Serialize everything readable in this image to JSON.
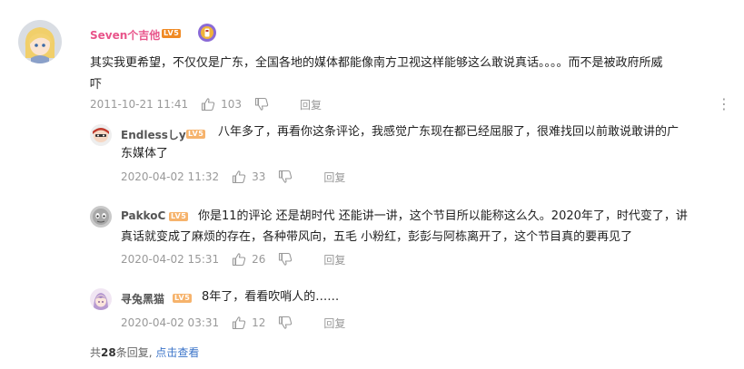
{
  "main_comment": {
    "username": "Seven个吉他",
    "level": "LV5",
    "text_line1": "其实我更希望，不仅仅是广东，全国各地的媒体都能像南方卫视这样能够这么敢说真话。。。。而不是被政府所威",
    "text_line2": "吓",
    "timestamp": "2011-10-21 11:41",
    "likes": "103",
    "reply_label": "回复",
    "more_label": "⋮"
  },
  "replies": [
    {
      "username": "Endlessしу",
      "level": "LV5",
      "text_line1": "八年多了，再看你这条评论，我感觉广东现在都已经屈服了，很难找回以前敢说敢讲的广",
      "text_line2": "东媒体了",
      "timestamp": "2020-04-02 11:32",
      "likes": "33",
      "reply_label": "回复"
    },
    {
      "username": "PakkoC",
      "level": "LV5",
      "text_line1": "你是11的评论 还是胡时代 还能讲一讲，这个节目所以能称这么久。2020年了，时代变了，讲",
      "text_line2": "真话就变成了麻烦的存在，各种带风向，五毛 小粉红，彭彭与阿栋离开了，这个节目真的要再见了",
      "timestamp": "2020-04-02 15:31",
      "likes": "26",
      "reply_label": "回复"
    },
    {
      "username": "寻兔黑猫",
      "level": "LV5",
      "text_line1": "8年了，看看吹哨人的……",
      "timestamp": "2020-04-02 03:31",
      "likes": "12",
      "reply_label": "回复"
    }
  ],
  "footer": {
    "prefix": "共",
    "count": "28",
    "suffix": "条回复,",
    "link": "点击查看"
  },
  "colors": {
    "username_main": "#e8548a",
    "username_reply": "#555555",
    "level_badge": "#f08a24",
    "link": "#3b74c9",
    "meta_gray": "#999999"
  },
  "icons": {
    "thumb_up": "thumb-up-icon",
    "thumb_down": "thumb-down-icon",
    "more": "more-icon",
    "badge": "medal-badge-icon"
  }
}
